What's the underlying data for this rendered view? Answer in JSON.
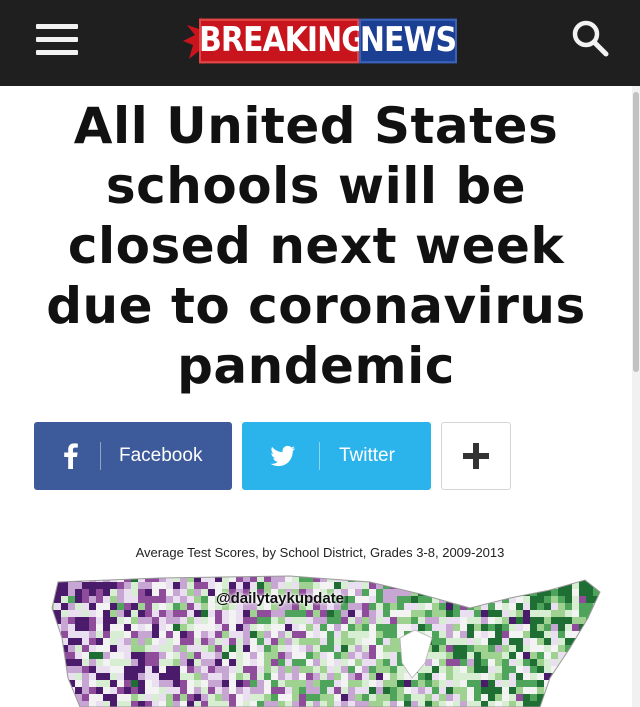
{
  "header": {
    "logo_word1": "BREAKING",
    "logo_word2": "NEWS",
    "menu_icon": "hamburger-menu-icon",
    "search_icon": "search-icon",
    "bar_color": "#1f1f1f",
    "logo_red": "#c8151d",
    "logo_blue": "#1b3f93"
  },
  "article": {
    "headline": "All United States schools will be closed next week due to coronavirus pandemic"
  },
  "share": {
    "facebook_label": "Facebook",
    "twitter_label": "Twitter",
    "facebook_icon": "facebook-icon",
    "twitter_icon": "twitter-bird-icon",
    "more_icon": "plus-icon",
    "facebook_color": "#3d5a9a",
    "twitter_color": "#2bb4ec"
  },
  "figure": {
    "caption": "Average Test Scores, by School District, Grades 3-8, 2009-2013",
    "watermark": "@dailytaykupdate",
    "palette": [
      "#4a1a6b",
      "#8e4c9a",
      "#c7a6d3",
      "#e9dff0",
      "#f3f3f3",
      "#d7eed2",
      "#9fd191",
      "#4ea45a",
      "#1f6f35"
    ]
  }
}
